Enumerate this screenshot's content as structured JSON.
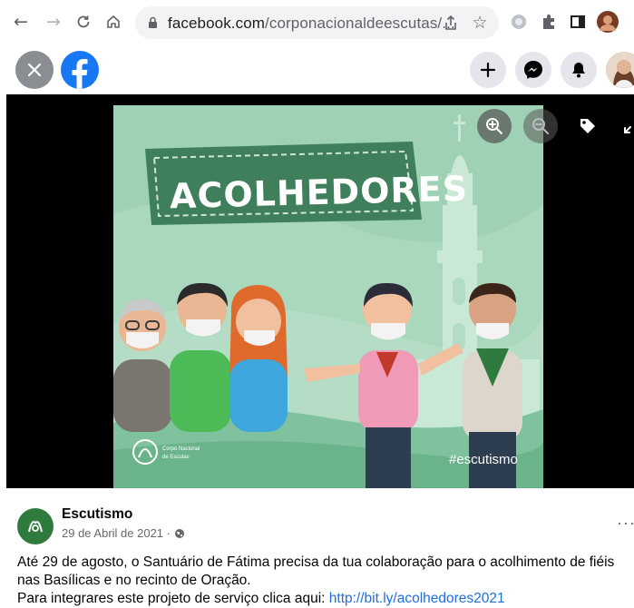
{
  "browser": {
    "url_domain": "facebook.com",
    "url_rest": "/corponacionaldeescutas/..."
  },
  "photo": {
    "banner_text": "ACOLHEDORES",
    "hashtag": "#escutismo",
    "logo_text_line1": "Corpo Nacional",
    "logo_text_line2": "de Escutas"
  },
  "post": {
    "page_name": "Escutismo",
    "date": "29 de Abril de 2021 ·",
    "more_label": "···",
    "text_line1": "Até 29 de agosto, o Santuário de Fátima precisa da tua colaboração para o acolhimento de fiéis",
    "text_line2": "nas Basílicas e no recinto de Oração.",
    "text_line3_prefix": "Para integrares este projeto de serviço clica aqui: ",
    "text_link": "http://bit.ly/acolhedores2021"
  },
  "colors": {
    "facebook_blue": "#1877f2",
    "link_blue": "#216fdb",
    "photo_green": "#9fd1b4",
    "banner_green": "#3f7f5c"
  },
  "icons": {
    "back": "arrow-left-icon",
    "forward": "arrow-right-icon",
    "reload": "reload-icon",
    "home": "home-icon",
    "share": "share-icon",
    "bookmark": "star-icon",
    "close": "close-icon",
    "create": "plus-icon",
    "messenger": "messenger-icon",
    "notifications": "bell-icon",
    "zoom_in": "zoom-in-icon",
    "zoom_out": "zoom-out-icon",
    "tag": "tag-icon",
    "expand": "expand-icon"
  }
}
